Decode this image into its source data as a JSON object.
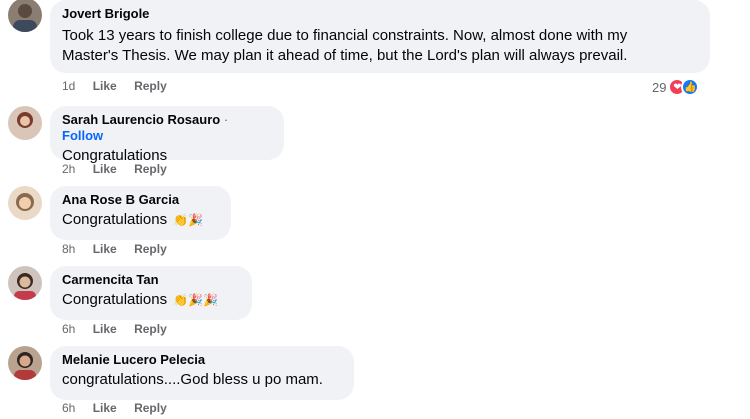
{
  "comments": [
    {
      "name": "Jovert Brigole",
      "text_lines": [
        "Took 13 years to finish college due to financial constraints. Now, almost done with my",
        "Master's Thesis. We may plan it ahead of time, but the Lord's plan will always prevail."
      ],
      "time": "1d",
      "like": "Like",
      "reply": "Reply",
      "reaction_count": "29",
      "reactions": [
        "heart-icon",
        "like-icon"
      ]
    },
    {
      "name": "Sarah Laurencio Rosauro",
      "follow_separator": "·",
      "follow": "Follow",
      "text": "Congratulations",
      "time": "2h",
      "like": "Like",
      "reply": "Reply"
    },
    {
      "name": "Ana Rose B Garcia",
      "text": "Congratulations",
      "emojis": "👏🎉",
      "time": "8h",
      "like": "Like",
      "reply": "Reply"
    },
    {
      "name": "Carmencita Tan",
      "text": "Congratulations",
      "emojis": "👏🎉🎉",
      "time": "6h",
      "like": "Like",
      "reply": "Reply"
    },
    {
      "name": "Melanie Lucero Pelecia",
      "text": "congratulations....God bless u po mam.",
      "time": "6h",
      "like": "Like",
      "reply": "Reply"
    }
  ]
}
